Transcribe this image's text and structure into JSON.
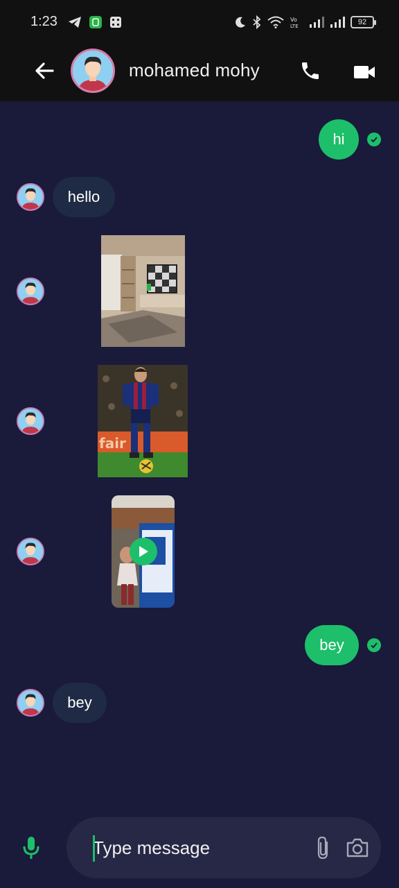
{
  "status_bar": {
    "time": "1:23",
    "battery": "92",
    "left_icons": [
      "telegram-icon",
      "app-icon",
      "dice-icon"
    ],
    "right_icons": [
      "moon-icon",
      "bluetooth-icon",
      "wifi-icon",
      "volte-icon",
      "signal-icon",
      "signal-icon",
      "battery-icon"
    ]
  },
  "header": {
    "contact_name": "mohamed mohy",
    "back_icon": "arrow-left-icon",
    "call_icon": "phone-icon",
    "video_icon": "video-camera-icon"
  },
  "messages": [
    {
      "from": "me",
      "type": "text",
      "text": "hi",
      "status": "read"
    },
    {
      "from": "them",
      "type": "text",
      "text": "hello"
    },
    {
      "from": "them",
      "type": "image",
      "description": "room-interior"
    },
    {
      "from": "them",
      "type": "image",
      "description": "football-player"
    },
    {
      "from": "them",
      "type": "video",
      "description": "child-with-box"
    },
    {
      "from": "me",
      "type": "text",
      "text": "bey",
      "status": "read"
    },
    {
      "from": "them",
      "type": "text",
      "text": "bey"
    }
  ],
  "composer": {
    "placeholder": "Type message",
    "mic_icon": "microphone-icon",
    "attach_icon": "paperclip-icon",
    "camera_icon": "camera-icon"
  },
  "colors": {
    "background": "#1a1a3b",
    "accent": "#1dbf6a",
    "incoming_bubble": "#1f2a44",
    "bar": "#111111"
  }
}
